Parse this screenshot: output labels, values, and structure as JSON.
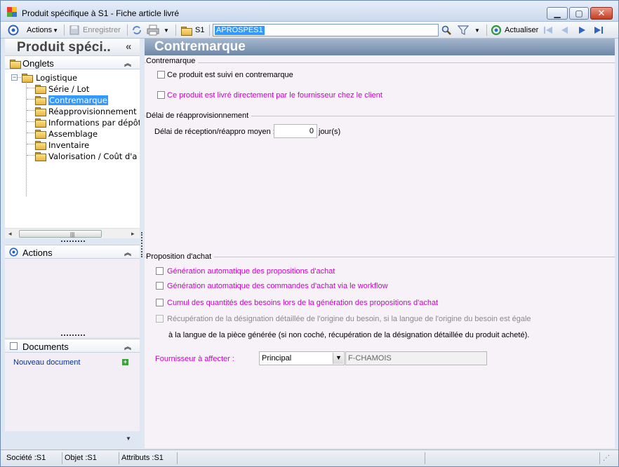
{
  "window": {
    "title": "Produit spécifique à S1 -  Fiche article livré"
  },
  "toolbar": {
    "actions_label": "Actions",
    "save_label": "Enregistrer",
    "site_label": "S1",
    "code_value": "APROSPES1",
    "refresh_label": "Actualiser"
  },
  "left": {
    "title": "Produit spéci..",
    "collapse_glyph": "«",
    "tabs_label": "Onglets",
    "tree": {
      "root": "Logistique",
      "items": [
        "Série / Lot",
        "Contremarque",
        "Réapprovisionnement",
        "Informations par dépôt",
        "Assemblage",
        "Inventaire",
        "Valorisation / Coût d'a"
      ],
      "selected_index": 1
    },
    "actions_label": "Actions",
    "documents_label": "Documents",
    "new_document_label": "Nouveau document"
  },
  "main": {
    "title": "Contremarque",
    "group_contremarque": {
      "title": "Contremarque",
      "opt1": "Ce produit est suivi en contremarque",
      "opt2": "Ce produit est livré directement par le fournisseur chez le client"
    },
    "group_delai": {
      "title": "Délai de réapprovisionnement",
      "field_label": "Délai de réception/réappro moyen :",
      "field_value": "0",
      "field_unit": "jour(s)"
    },
    "group_proposition": {
      "title": "Proposition d'achat",
      "opt1": "Génération automatique des propositions d'achat",
      "opt2": "Génération automatique des commandes d'achat via le workflow",
      "opt3": "Cumul des quantités des besoins lors de la génération des propositions d'achat",
      "opt4_line1": "Récupération de la désignation détaillée de l'origine du besoin, si la langue de l'origine du besoin est égale",
      "opt4_line2": "à la langue de la pièce générée (si non coché, récupération de la désignation détaillée du produit acheté).",
      "supplier_label": "Fournisseur à affecter :",
      "supplier_select": "Principal",
      "supplier_value": "F-CHAMOIS"
    }
  },
  "status": {
    "company": "Société :S1",
    "object": "Objet :S1",
    "attributes": "Attributs :S1"
  },
  "colors": {
    "accent": "#3399ff",
    "magenta_label": "#cc00cc",
    "header_blue": "#6f87a8"
  }
}
